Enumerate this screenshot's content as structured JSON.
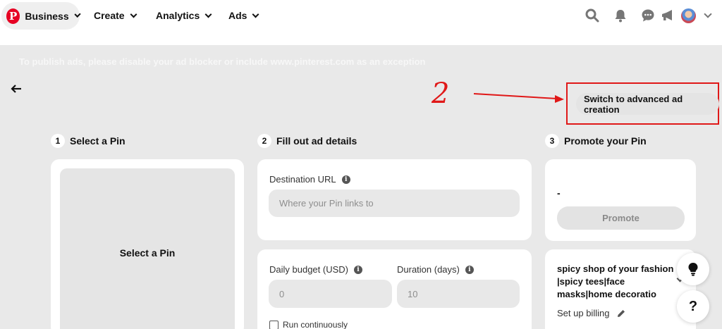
{
  "nav": {
    "business_label": "Business",
    "create_label": "Create",
    "analytics_label": "Analytics",
    "ads_label": "Ads",
    "logo_letter": "P"
  },
  "banner_text": "To publish ads, please disable your ad blocker or include www.pinterest.com as an exception",
  "annotation_mark": "2",
  "advanced_button": "Switch to advanced ad creation",
  "steps": [
    {
      "number": "1",
      "label": "Select a Pin"
    },
    {
      "number": "2",
      "label": "Fill out ad details"
    },
    {
      "number": "3",
      "label": "Promote your Pin"
    }
  ],
  "pin_area_label": "Select a Pin",
  "destination": {
    "label": "Destination URL",
    "placeholder": "Where your Pin links to"
  },
  "budget": {
    "daily_label": "Daily budget (USD)",
    "daily_value": "0",
    "duration_label": "Duration (days)",
    "duration_value": "10",
    "run_continuously": "Run continuously"
  },
  "promote": {
    "value": "-",
    "button": "Promote"
  },
  "account": {
    "name": "spicy shop of your fashion |spicy tees|face masks|home decoratio",
    "billing": "Set up billing"
  },
  "help_label": "?",
  "info_glyph": "i",
  "colors": {
    "brand_red": "#e60023",
    "annotation_red": "#e01818",
    "page_bg": "#e9e9e9"
  },
  "icons": [
    "search-icon",
    "bell-icon",
    "messages-icon",
    "megaphone-icon",
    "back-arrow-icon",
    "lightbulb-icon",
    "pencil-icon"
  ]
}
